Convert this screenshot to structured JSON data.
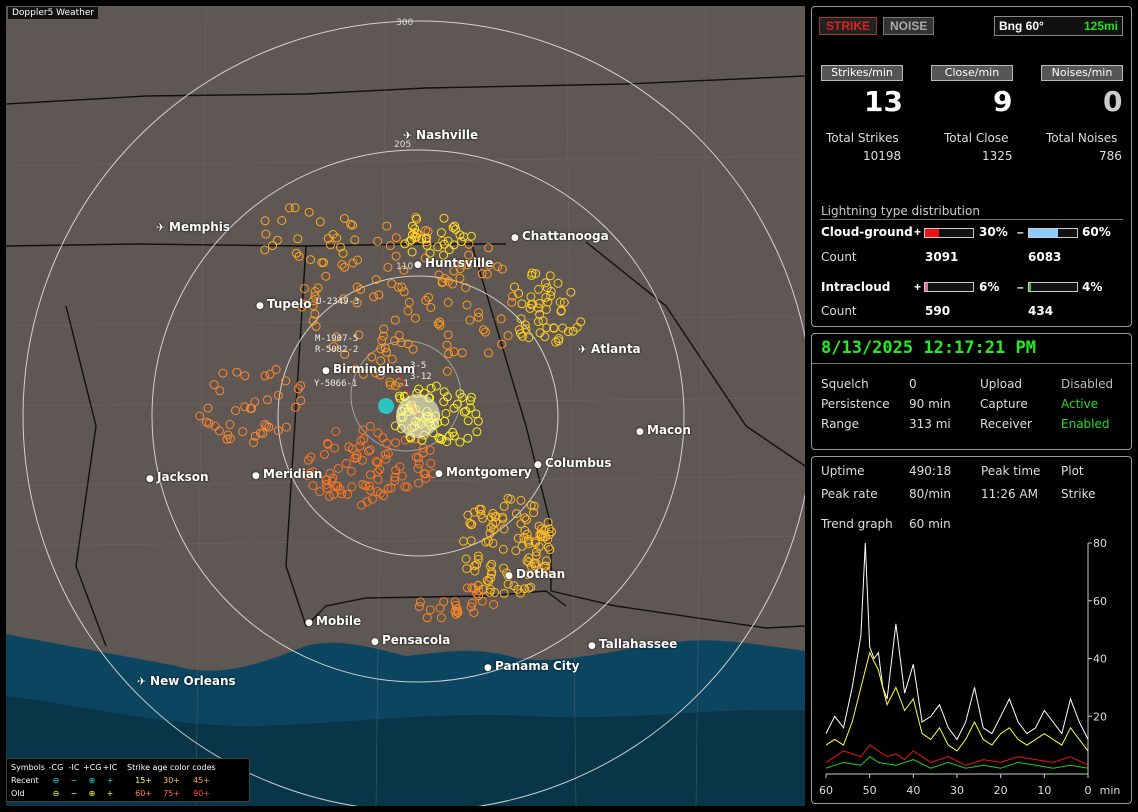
{
  "map": {
    "app_title": "Doppler5 Weather",
    "ring_labels": [
      "300",
      "205",
      "110"
    ],
    "cities": [
      {
        "name": "Nashville",
        "icon": "airport-icon"
      },
      {
        "name": "Chattanooga",
        "icon": "dot-icon"
      },
      {
        "name": "Memphis",
        "icon": "airport-icon"
      },
      {
        "name": "Huntsville",
        "icon": "dot-icon"
      },
      {
        "name": "Tupelo",
        "icon": "dot-icon"
      },
      {
        "name": "Atlanta",
        "icon": "airport-icon"
      },
      {
        "name": "Birmingham",
        "icon": "dot-icon"
      },
      {
        "name": "Macon",
        "icon": "dot-icon"
      },
      {
        "name": "Jackson",
        "icon": "dot-icon"
      },
      {
        "name": "Meridian",
        "icon": "dot-icon"
      },
      {
        "name": "Montgomery",
        "icon": "dot-icon"
      },
      {
        "name": "Columbus",
        "icon": "dot-icon"
      },
      {
        "name": "Dothan",
        "icon": "dot-icon"
      },
      {
        "name": "Mobile",
        "icon": "dot-icon"
      },
      {
        "name": "Pensacola",
        "icon": "dot-icon"
      },
      {
        "name": "Tallahassee",
        "icon": "dot-icon"
      },
      {
        "name": "Panama City",
        "icon": "dot-icon"
      },
      {
        "name": "New Orleans",
        "icon": "airport-icon"
      }
    ],
    "rdf_labels": [
      "U-2349-3",
      "M-1907-5",
      "R-5082-2",
      "Y-5066-1",
      "3-5",
      "3-12",
      "-1"
    ]
  },
  "legend": {
    "header": {
      "symbols": "Symbols",
      "neg_cg": "-CG",
      "neg_ic": "-IC",
      "pos_cg": "+CG",
      "pos_ic": "+IC",
      "age": "Strike age color codes"
    },
    "recent": {
      "label": "Recent",
      "ages": [
        "15+",
        "30+",
        "45+"
      ]
    },
    "old": {
      "label": "Old",
      "ages": [
        "60+",
        "75+",
        "90+"
      ]
    }
  },
  "counts": {
    "tab_strike": "STRIKE",
    "tab_noise": "NOISE",
    "bearing": "Bng 60°",
    "range": "125mi",
    "strikes_per_min_label": "Strikes/min",
    "close_per_min_label": "Close/min",
    "noises_per_min_label": "Noises/min",
    "strikes_per_min": "13",
    "close_per_min": "9",
    "noises_per_min": "0",
    "total_strikes_label": "Total Strikes",
    "total_close_label": "Total Close",
    "total_noises_label": "Total Noises",
    "total_strikes": "10198",
    "total_close": "1325",
    "total_noises": "786"
  },
  "distribution": {
    "title": "Lightning type distribution",
    "cg_label": "Cloud-ground",
    "ic_label": "Intracloud",
    "count_label": "Count",
    "cg_pos_sign": "+",
    "cg_pos_pct": "30%",
    "cg_pos_fraction": 0.3,
    "cg_pos_count": "3091",
    "cg_neg_sign": "–",
    "cg_neg_pct": "60%",
    "cg_neg_fraction": 0.6,
    "cg_neg_count": "6083",
    "ic_pos_sign": "+",
    "ic_pos_pct": "6%",
    "ic_pos_fraction": 0.06,
    "ic_pos_count": "590",
    "ic_neg_sign": "–",
    "ic_neg_pct": "4%",
    "ic_neg_fraction": 0.04,
    "ic_neg_count": "434",
    "colors": {
      "cg_pos": "#ee1111",
      "cg_neg": "#88ccff",
      "ic_pos": "#ee66aa",
      "ic_neg": "#22cc22"
    }
  },
  "status": {
    "datetime": "8/13/2025 12:17:21 PM",
    "squelch_label": "Squelch",
    "squelch": "0",
    "persistence_label": "Persistence",
    "persistence": "90 min",
    "range_label": "Range",
    "range": "313 mi",
    "upload_label": "Upload",
    "upload": "Disabled",
    "capture_label": "Capture",
    "capture": "Active",
    "receiver_label": "Receiver",
    "receiver": "Enabled"
  },
  "trend": {
    "uptime_label": "Uptime",
    "uptime": "490:18",
    "peak_time_label": "Peak time",
    "peak_time": "11:26 AM",
    "plot_label": "Plot",
    "plot": "Strike",
    "peak_rate_label": "Peak rate",
    "peak_rate": "80/min",
    "trend_graph_label": "Trend graph",
    "trend_graph": "60 min",
    "x_tick_labels": [
      "60",
      "50",
      "40",
      "30",
      "20",
      "10",
      "0",
      "min"
    ],
    "y_tick_labels": [
      "80",
      "60",
      "40",
      "20"
    ]
  },
  "chart_data": {
    "type": "line",
    "title": "",
    "xlabel": "min",
    "ylabel": "",
    "xlim": [
      60,
      0
    ],
    "ylim": [
      0,
      80
    ],
    "series": [
      {
        "color": "#ffffff",
        "x": [
          60,
          58,
          56,
          54,
          52,
          51,
          50,
          49,
          48,
          47,
          46,
          44,
          42,
          40,
          38,
          36,
          34,
          32,
          30,
          28,
          26,
          24,
          22,
          20,
          18,
          16,
          14,
          12,
          10,
          8,
          6,
          4,
          2,
          0
        ],
        "y": [
          14,
          20,
          16,
          30,
          48,
          80,
          44,
          40,
          42,
          30,
          26,
          52,
          28,
          38,
          18,
          20,
          24,
          16,
          12,
          18,
          30,
          16,
          14,
          20,
          26,
          18,
          14,
          16,
          22,
          18,
          14,
          26,
          18,
          12
        ]
      },
      {
        "color": "#ffff33",
        "x": [
          60,
          58,
          56,
          54,
          52,
          50,
          48,
          46,
          44,
          42,
          40,
          38,
          36,
          34,
          32,
          30,
          28,
          26,
          24,
          22,
          20,
          18,
          16,
          14,
          12,
          10,
          8,
          6,
          4,
          2,
          0
        ],
        "y": [
          10,
          12,
          10,
          18,
          30,
          42,
          36,
          24,
          30,
          22,
          26,
          14,
          12,
          16,
          10,
          8,
          12,
          18,
          12,
          10,
          14,
          16,
          12,
          10,
          12,
          14,
          12,
          10,
          16,
          12,
          8
        ]
      },
      {
        "color": "#ee1111",
        "x": [
          60,
          56,
          52,
          50,
          48,
          46,
          44,
          42,
          40,
          36,
          32,
          28,
          24,
          20,
          16,
          12,
          8,
          4,
          0
        ],
        "y": [
          4,
          8,
          6,
          10,
          8,
          6,
          7,
          5,
          8,
          4,
          6,
          3,
          5,
          4,
          6,
          5,
          4,
          6,
          3
        ]
      },
      {
        "color": "#22cc22",
        "x": [
          60,
          56,
          52,
          50,
          48,
          44,
          40,
          36,
          32,
          28,
          24,
          20,
          16,
          12,
          8,
          4,
          0
        ],
        "y": [
          2,
          4,
          3,
          6,
          4,
          3,
          5,
          2,
          4,
          2,
          3,
          2,
          4,
          3,
          2,
          3,
          2
        ]
      }
    ]
  }
}
